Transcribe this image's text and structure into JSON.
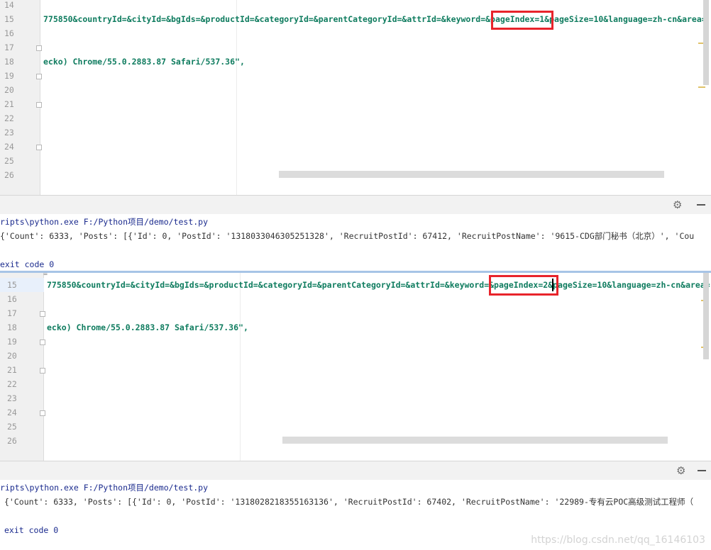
{
  "top": {
    "line_numbers": [
      "14",
      "15",
      "16",
      "17",
      "18",
      "19",
      "20",
      "21",
      "22",
      "23",
      "24",
      "25",
      "26"
    ],
    "url_line": "775850&countryId=&cityId=&bgIds=&productId=&categoryId=&parentCategoryId=&attrId=&keyword=&pageIndex=1&pageSize=10&language=zh-cn&area=",
    "ua_line": "ecko) Chrome/55.0.2883.87 Safari/537.36\",",
    "console_cmd": "ripts\\python.exe F:/Python项目/demo/test.py",
    "console_output": "{'Count': 6333, 'Posts': [{'Id': 0, 'PostId': '1318033046305251328', 'RecruitPostId': 67412, 'RecruitPostName': '9615-CDG部门秘书（北京）', 'Cou",
    "console_exit": "exit code 0"
  },
  "bottom": {
    "line_numbers": [
      "15",
      "16",
      "17",
      "18",
      "19",
      "20",
      "21",
      "22",
      "23",
      "24",
      "25",
      "26"
    ],
    "url_line": "775850&countryId=&cityId=&bgIds=&productId=&categoryId=&parentCategoryId=&attrId=&keyword=&pageIndex=2&pageSize=10&language=zh-cn&area=",
    "ua_line": "ecko) Chrome/55.0.2883.87 Safari/537.36\",",
    "console_cmd": "ripts\\python.exe F:/Python项目/demo/test.py",
    "console_output": "{'Count': 6333, 'Posts': [{'Id': 0, 'PostId': '1318028218355163136', 'RecruitPostId': 67402, 'RecruitPostName': '22989-专有云POC高级测试工程师（",
    "console_exit": "exit code 0"
  },
  "toolbar": {
    "settings_icon": "gear-icon",
    "hide_icon": "minus-icon"
  },
  "watermark": "https://blog.csdn.net/qq_16146103",
  "colors": {
    "highlight_box": "#e8242b",
    "code_text": "#0f7c5f",
    "console_text": "#1b2b8e"
  }
}
